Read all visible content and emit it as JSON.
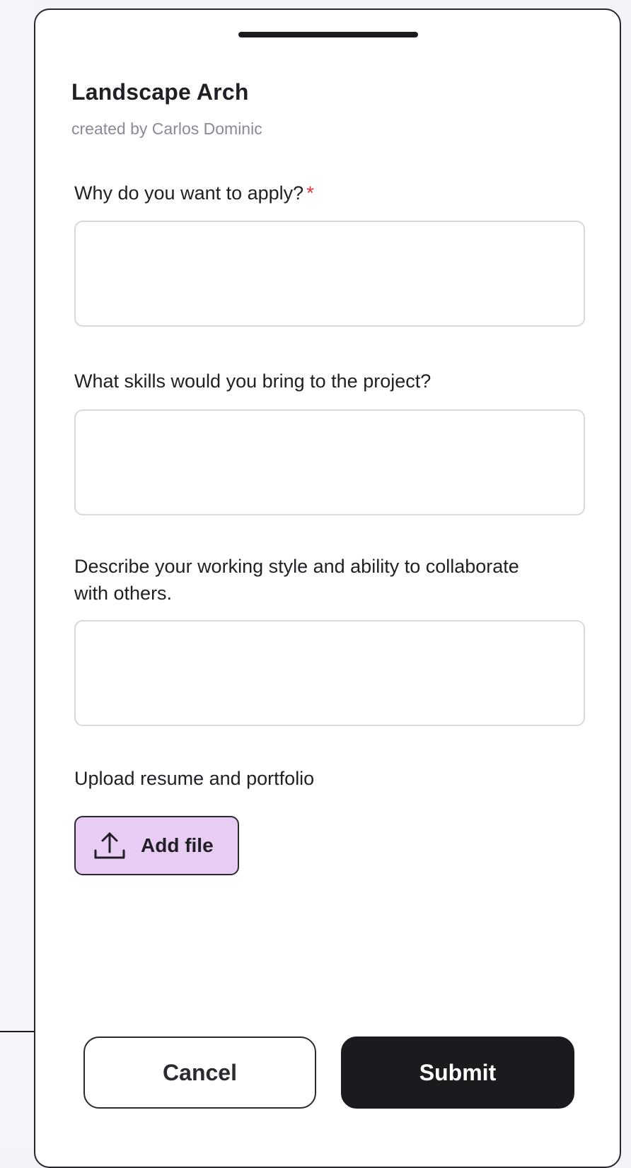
{
  "project": {
    "title": "Landscape Arch",
    "subtitle": "created by Carlos Dominic"
  },
  "questions": [
    {
      "label": "Why do you want to apply?",
      "required_marker": "*",
      "value": ""
    },
    {
      "label": "What skills would you bring to the project?",
      "value": ""
    },
    {
      "label": "Describe your working style and ability to collaborate with others.",
      "value": ""
    }
  ],
  "upload": {
    "label": "Upload resume and portfolio",
    "button_label": "Add file",
    "icon": "upload-icon"
  },
  "actions": {
    "cancel_label": "Cancel",
    "submit_label": "Submit"
  },
  "colors": {
    "add_file_bg": "#e8ccf4",
    "submit_bg": "#1a1b1f",
    "required": "#e3323b"
  }
}
